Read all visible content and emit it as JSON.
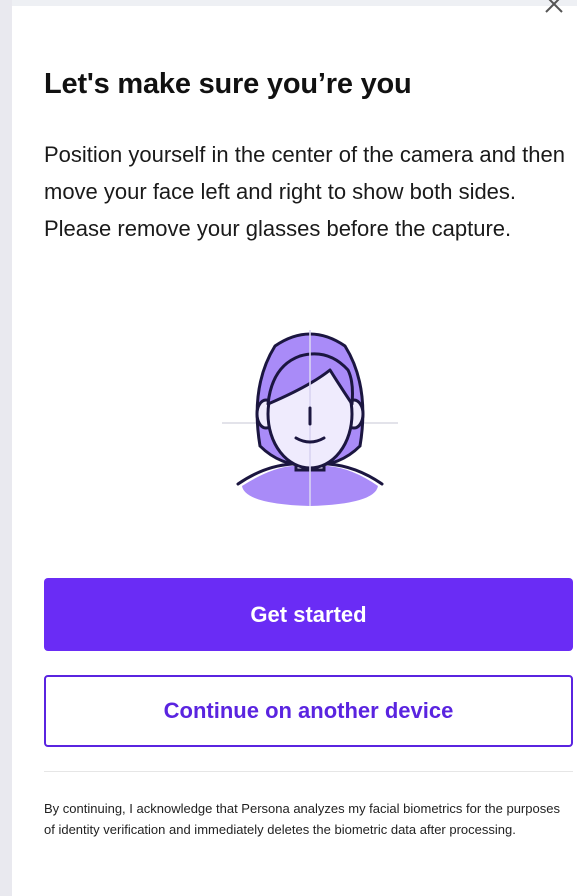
{
  "dialog": {
    "close_icon": "close-icon",
    "title": "Let's make sure you’re you",
    "description": "Position yourself in the center of the camera and then move your face left and right to show both sides. Please remove your glasses before the capture.",
    "illustration_icon": "face-selfie-icon",
    "primary_button_label": "Get started",
    "secondary_button_label": "Continue on another device",
    "disclaimer": "By continuing, I acknowledge that Persona analyzes my facial biometrics for the purposes of identity verification and immediately deletes the biometric data after processing."
  },
  "colors": {
    "accent": "#6a2cf5",
    "accent_dark": "#5a24e0",
    "illustration_fill": "#efebfd",
    "illustration_stroke": "#1b1640",
    "illustration_hair": "#a98bf8"
  }
}
